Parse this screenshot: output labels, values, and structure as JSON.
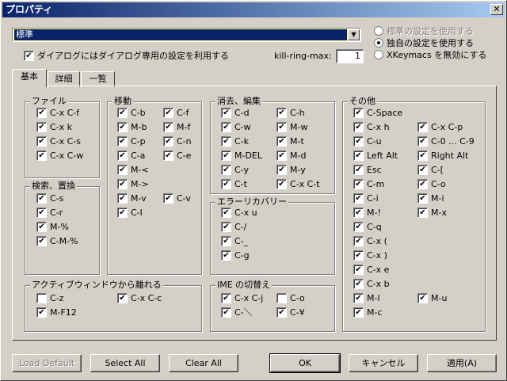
{
  "window": {
    "title": "プロパティ",
    "close_glyph": "✕"
  },
  "top": {
    "combo_value": "標準",
    "combo_arrow": "▼",
    "dialog_checkbox_label": "ダイアログにはダイアログ専用の設定を利用する",
    "kill_ring_label": "kill-ring-max:",
    "kill_ring_value": "1",
    "radios": [
      {
        "label": "標準の設定を使用する",
        "checked": false,
        "disabled": true
      },
      {
        "label": "独自の設定を使用する",
        "checked": true,
        "disabled": false
      },
      {
        "label": "XKeymacs を無効にする",
        "checked": false,
        "disabled": false
      }
    ]
  },
  "tabs": [
    "基本",
    "詳細",
    "一覧"
  ],
  "groups": {
    "file": {
      "label": "ファイル",
      "items": [
        "C-x C-f",
        "C-x k",
        "C-x C-s",
        "C-x C-w"
      ]
    },
    "search": {
      "label": "検索、置換",
      "items": [
        "C-s",
        "C-r",
        "M-%",
        "C-M-%"
      ]
    },
    "move": {
      "label": "移動",
      "left": [
        "C-b",
        "M-b",
        "C-p",
        "C-a",
        "M-<",
        "M->",
        "M-v",
        "C-l"
      ],
      "right": [
        "C-f",
        "M-f",
        "C-n",
        "C-e",
        "C-v"
      ]
    },
    "active": {
      "label": "アクティブウィンドウから離れる",
      "items": [
        "C-z",
        "C-x C-c",
        "M-F12"
      ]
    },
    "edit": {
      "label": "消去、編集",
      "left": [
        "C-d",
        "C-w",
        "C-k",
        "M-DEL",
        "C-y",
        "C-t"
      ],
      "right": [
        "C-h",
        "M-w",
        "M-t",
        "M-d",
        "M-y",
        "C-x C-t"
      ]
    },
    "error": {
      "label": "エラーリカバリー",
      "items": [
        "C-x u",
        "C-/",
        "C-_",
        "C-g"
      ]
    },
    "ime": {
      "label": "IME の切替え",
      "items": [
        "C-x C-j",
        "C-o",
        "C-＼",
        "C-¥"
      ]
    },
    "other": {
      "label": "その他",
      "left": [
        "C-Space",
        "C-x h",
        "C-u",
        "Left Alt",
        "Esc",
        "C-m",
        "C-i",
        "M-!",
        "C-q",
        "C-x (",
        "C-x )",
        "C-x e",
        "C-x b",
        "M-l",
        "M-c"
      ],
      "right": [
        "C-x C-p",
        "C-0 ... C-9",
        "Right Alt",
        "C-[",
        "C-o",
        "M-i",
        "M-x",
        "M-u"
      ]
    }
  },
  "buttons": {
    "load_default": "Load Default",
    "select_all": "Select All",
    "clear_all": "Clear All",
    "ok": "OK",
    "cancel": "キャンセル",
    "apply": "適用(A)"
  }
}
